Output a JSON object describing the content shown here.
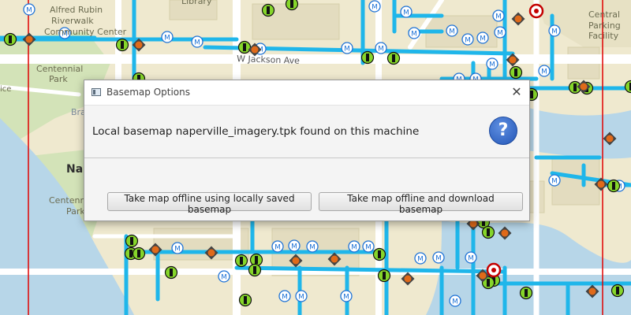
{
  "map": {
    "labels": {
      "alfred_1": "Alfred Rubin",
      "alfred_2": "Riverwalk",
      "alfred_3": "Community Center",
      "library": "Library",
      "centennial_park_1": "Centennial",
      "centennial_park_2": "Park",
      "jackson_ave": "W Jackson Ave",
      "central_parking_1": "Central",
      "central_parking_2": "Parking",
      "central_parking_3": "Facility",
      "ice": "ice",
      "bra": "Bra",
      "na": "Na",
      "centenn_lower": "Centenn",
      "park_lower": "Park"
    },
    "colors": {
      "road": "#ffffff",
      "water": "#b7d6e8",
      "park": "#d3e3b8",
      "block": "#efe9cf",
      "building": "#e3dcbf",
      "pipe": "#1fb6ea",
      "meter": "#1f73d6",
      "valve": "#86d62a",
      "hydrant": "#e06a1a",
      "boundary": "#e00000"
    }
  },
  "dialog": {
    "title": "Basemap Options",
    "close_icon": "close-icon",
    "message": "Local basemap naperville_imagery.tpk found on this machine",
    "question_glyph": "?",
    "buttons": {
      "local": "Take map offline using locally saved basemap",
      "download": "Take map offline and download basemap"
    }
  }
}
